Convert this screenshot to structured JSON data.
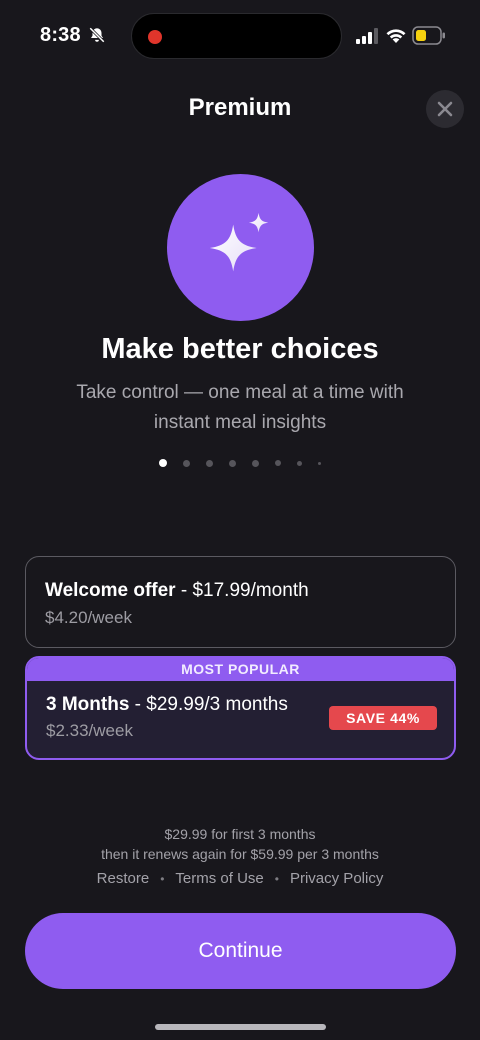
{
  "status_bar": {
    "time": "8:38",
    "icons": [
      "bell-slash-icon",
      "recording-dot",
      "signal-icon",
      "wifi-icon",
      "battery-icon"
    ]
  },
  "header": {
    "title": "Premium",
    "close_icon": "close-icon"
  },
  "hero": {
    "icon": "sparkles-icon",
    "title": "Make better choices",
    "subtitle": "Take control — one meal at a time with instant meal insights"
  },
  "pager": {
    "count": 8,
    "active_index": 0
  },
  "plans": {
    "welcome": {
      "name": "Welcome offer",
      "price": " - $17.99/month",
      "per_week": "$4.20/week"
    },
    "popular": {
      "banner": "MOST POPULAR",
      "name": "3 Months",
      "price": " - $29.99/3 months",
      "per_week": "$2.33/week",
      "badge": "SAVE 44%"
    }
  },
  "terms": {
    "line1": "$29.99 for first 3 months",
    "line2": "then it renews again for $59.99 per 3 months"
  },
  "links": {
    "restore": "Restore",
    "separator": "•",
    "terms": "Terms of Use",
    "privacy": "Privacy Policy"
  },
  "cta": {
    "label": "Continue"
  },
  "colors": {
    "background": "#18171c",
    "accent": "#8f5cf0",
    "badge": "#e5484d",
    "muted_text": "#a9a8ae"
  }
}
